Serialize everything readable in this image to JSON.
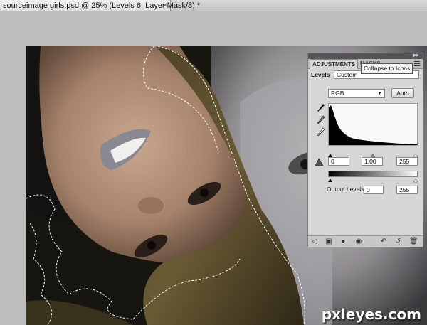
{
  "document_tab": {
    "title": "sourceimage girls.psd @ 25% (Levels 6, Layer Mask/8) *",
    "close_glyph": "×"
  },
  "panel": {
    "tab_adjustments": "ADJUSTMENTS",
    "tab_masks": "MASKS",
    "tooltip": "Collapse to Icons",
    "levels_label": "Levels",
    "preset_value": "Custom",
    "channel_value": "RGB",
    "auto_label": "Auto",
    "input_black": "0",
    "input_gamma": "1.00",
    "input_white": "255",
    "output_label": "Output Levels:",
    "output_black": "0",
    "output_white": "255"
  },
  "watermark": "pxleyes.com",
  "icons": {
    "eyedropper_black": "eyedropper-black-icon",
    "eyedropper_gray": "eyedropper-gray-icon",
    "eyedropper_white": "eyedropper-white-icon",
    "clip_warning": "clipping-warning-icon",
    "panel_menu": "panel-menu-icon"
  }
}
